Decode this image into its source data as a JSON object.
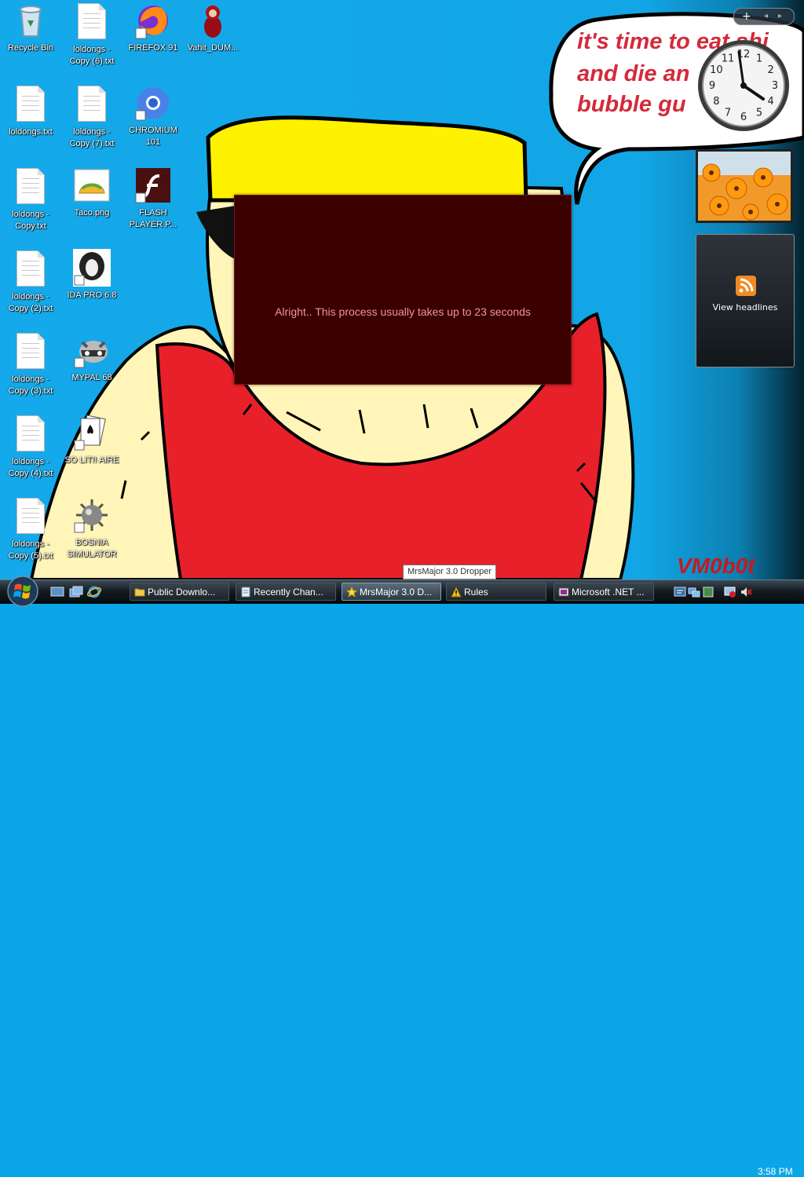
{
  "desktop_icons": [
    {
      "label": "Recycle Bin",
      "icon": "recycle-bin-icon"
    },
    {
      "label": "loldongs - Copy (6).txt",
      "icon": "text-file-icon"
    },
    {
      "label": "FIREFOX 91",
      "icon": "firefox-icon"
    },
    {
      "label": "Vahit_DUM...",
      "icon": "doll-icon"
    },
    {
      "label": "loldongs.txt",
      "icon": "text-file-icon"
    },
    {
      "label": "loldongs - Copy (7).txt",
      "icon": "text-file-icon"
    },
    {
      "label": "CHROMIUM 101",
      "icon": "chromium-icon"
    },
    {
      "label": "loldongs - Copy.txt",
      "icon": "text-file-icon"
    },
    {
      "label": "Taco.png",
      "icon": "image-file-icon"
    },
    {
      "label": "FLASH PLAYER P...",
      "icon": "flash-player-icon"
    },
    {
      "label": "loldongs - Copy (2).txt",
      "icon": "text-file-icon"
    },
    {
      "label": "IDA PRO 6.8",
      "icon": "ida-pro-icon"
    },
    {
      "label": "loldongs - Copy (3).txt",
      "icon": "text-file-icon"
    },
    {
      "label": "MYPAL 68",
      "icon": "raccoon-icon"
    },
    {
      "label": "loldongs - Copy (4).txt",
      "icon": "text-file-icon"
    },
    {
      "label": "SO LIT!! AIRE",
      "icon": "solitaire-icon"
    },
    {
      "label": "loldongs - Copy (5).txt",
      "icon": "text-file-icon"
    },
    {
      "label": "BOSNIA SIMULATOR",
      "icon": "minesweeper-icon"
    }
  ],
  "wallpaper": {
    "speech_lines": [
      "it's time to eat shi",
      "and die an",
      "bubble gu"
    ],
    "signature": "VM0b0t"
  },
  "gadgets": {
    "clock_numbers": [
      "12",
      "1",
      "2",
      "3",
      "4",
      "5",
      "6",
      "7",
      "8",
      "9",
      "10",
      "11"
    ],
    "feed_label": "View headlines"
  },
  "dialog": {
    "message": "Alright.. This process usually takes up to 23 seconds"
  },
  "tooltip": "MrsMajor 3.0 Dropper",
  "taskbar": {
    "buttons": [
      {
        "label": "Public Downlo...",
        "icon": "folder-icon"
      },
      {
        "label": "Recently Chan...",
        "icon": "notepad-icon"
      },
      {
        "label": "MrsMajor 3.0 D...",
        "icon": "star-icon",
        "active": true
      },
      {
        "label": "Rules",
        "icon": "warning-icon"
      },
      {
        "label": "Microsoft .NET ...",
        "icon": "dotnet-icon"
      }
    ],
    "clock": "3:58 PM"
  },
  "colors": {
    "desktop_blue": "#12a6e6",
    "dialog_bg": "#3a0000",
    "dialog_text": "#f19595",
    "speech_text": "#d42a3a",
    "shirt_red": "#e8202a",
    "hair_yellow": "#fff200",
    "skin": "#fff5b8"
  }
}
